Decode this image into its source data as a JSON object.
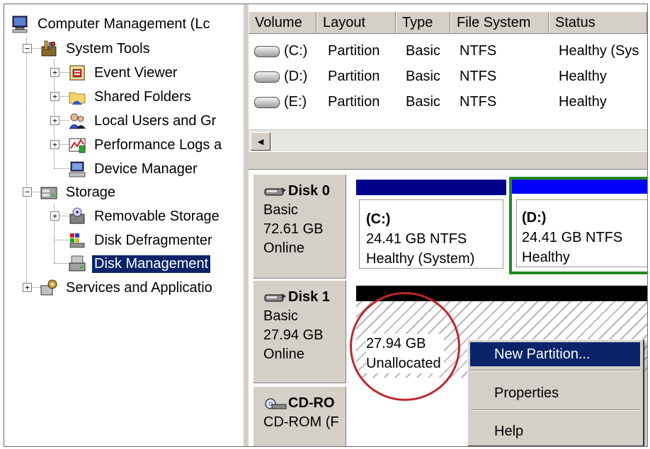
{
  "tree": {
    "root": "Computer Management (Lc",
    "system_tools": "System Tools",
    "event_viewer": "Event Viewer",
    "shared_folders": "Shared Folders",
    "local_users": "Local Users and Gr",
    "perf_logs": "Performance Logs a",
    "device_manager": "Device Manager",
    "storage": "Storage",
    "removable_storage": "Removable Storage",
    "disk_defragmenter": "Disk Defragmenter",
    "disk_management": "Disk Management",
    "services_apps": "Services and Applicatio",
    "expander_collapsed": "+",
    "expander_expanded": "−"
  },
  "volume_list": {
    "columns": [
      "Volume",
      "Layout",
      "Type",
      "File System",
      "Status"
    ],
    "rows": [
      {
        "volume": "(C:)",
        "layout": "Partition",
        "type": "Basic",
        "fs": "NTFS",
        "status": "Healthy (Sys"
      },
      {
        "volume": "(D:)",
        "layout": "Partition",
        "type": "Basic",
        "fs": "NTFS",
        "status": "Healthy"
      },
      {
        "volume": "(E:)",
        "layout": "Partition",
        "type": "Basic",
        "fs": "NTFS",
        "status": "Healthy"
      }
    ],
    "scroll_left": "◄"
  },
  "disks": [
    {
      "name": "Disk 0",
      "type": "Basic",
      "size": "72.61 GB",
      "state": "Online"
    },
    {
      "name": "Disk 1",
      "type": "Basic",
      "size": "27.94 GB",
      "state": "Online"
    },
    {
      "name": "CD-RO",
      "type": "CD-ROM (F"
    }
  ],
  "partitions": {
    "c": {
      "title": "(C:)",
      "size": "24.41 GB NTFS",
      "status": "Healthy (System)"
    },
    "d": {
      "title": "(D:)",
      "size": "24.41 GB NTFS",
      "status": "Healthy"
    },
    "unalloc": {
      "size": "27.94 GB",
      "status": "Unallocated"
    }
  },
  "context_menu": {
    "new_partition": "New Partition...",
    "properties": "Properties",
    "help": "Help"
  },
  "colors": {
    "primary_partition_bar": "#00008b",
    "selected_partition_border": "#1f8a1f",
    "unallocated_bar": "#000000",
    "selection": "#0a246a",
    "annotation_circle": "#c0262b"
  }
}
